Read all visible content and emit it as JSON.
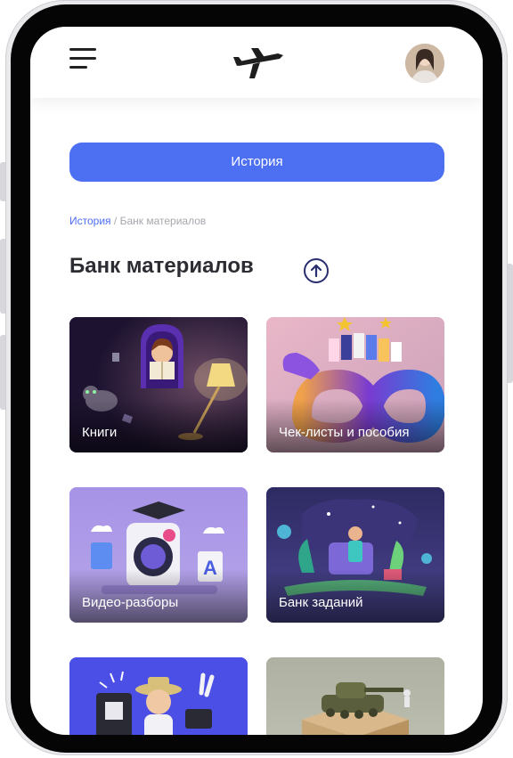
{
  "header": {
    "menu_icon": "hamburger-menu-icon",
    "logo_icon": "airplane-logo-icon",
    "avatar": "user-avatar"
  },
  "history_button": {
    "label": "История"
  },
  "breadcrumb": {
    "link": "История",
    "separator": " / ",
    "current": "Банк материалов"
  },
  "page": {
    "title": "Банк материалов",
    "scroll_up_icon": "arrow-up-circle-icon"
  },
  "cards": [
    {
      "label": "Книги",
      "bg": "#2a1a3e"
    },
    {
      "label": "Чек-листы и пособия",
      "bg": "#e7b4c6"
    },
    {
      "label": "Видео-разборы",
      "bg": "#a995e0"
    },
    {
      "label": "Банк заданий",
      "bg": "#3d3a78"
    },
    {
      "label": "",
      "bg": "#4b4fe6"
    },
    {
      "label": "",
      "bg": "#b7b9a9"
    }
  ],
  "colors": {
    "accent": "#4d6ff2",
    "title": "#2c2c33",
    "breadcrumb_muted": "#a7a7ae"
  }
}
